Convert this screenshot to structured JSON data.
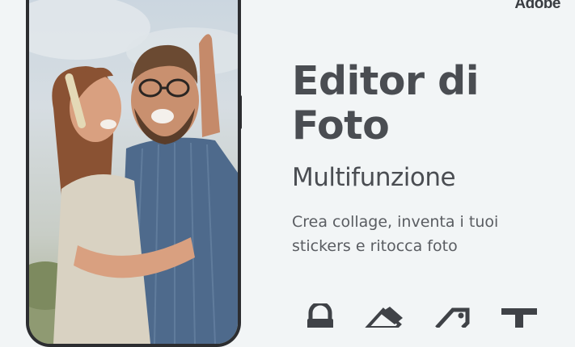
{
  "brand": {
    "name": "Adobe"
  },
  "headline": {
    "line1": "Editor di",
    "line2": "Foto"
  },
  "subtitle": "Multifunzione",
  "description": {
    "line1": "Crea collage, inventa i tuoi",
    "line2": "stickers e ritocca foto"
  },
  "tools": [
    {
      "icon": "lock-icon"
    },
    {
      "icon": "eraser-icon"
    },
    {
      "icon": "tag-icon"
    },
    {
      "icon": "text-icon"
    }
  ],
  "colors": {
    "background": "#f2f5f6",
    "text": "#4a4d52",
    "phone": "#2c2d30"
  }
}
